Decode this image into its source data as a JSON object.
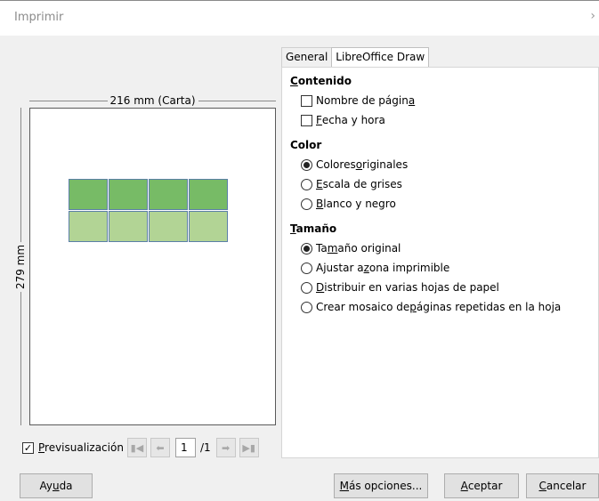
{
  "window": {
    "title": "Imprimir",
    "collapse_glyph": "›"
  },
  "preview": {
    "width_label": "216 mm (Carta)",
    "height_label": "279 mm",
    "checkbox_checked": true,
    "checkbox_label_pre": "",
    "checkbox_label_u": "P",
    "checkbox_label_post": "revisualización",
    "current_page": "1",
    "page_count": "/1",
    "nav_icons": [
      "first-page-icon",
      "previous-page-icon",
      "next-page-icon",
      "last-page-icon"
    ]
  },
  "tabs": [
    {
      "label": "General",
      "active": false
    },
    {
      "label": "LibreOffice Draw",
      "active": true
    }
  ],
  "contenido": {
    "heading_u": "C",
    "heading_rest": "ontenido",
    "options": [
      {
        "pre": "Nombre de págin",
        "u": "a",
        "post": "",
        "checked": false
      },
      {
        "pre": "",
        "u": "F",
        "post": "echa y hora",
        "checked": false
      }
    ]
  },
  "color": {
    "heading": "Color",
    "options": [
      {
        "pre": "Colores ",
        "u": "o",
        "post": "riginales",
        "selected": true
      },
      {
        "pre": "",
        "u": "E",
        "post": "scala de grises",
        "selected": false
      },
      {
        "pre": "",
        "u": "B",
        "post": "lanco y negro",
        "selected": false
      }
    ]
  },
  "tamano": {
    "heading_u": "T",
    "heading_rest": "amaño",
    "options": [
      {
        "pre": "Ta",
        "u": "m",
        "post": "año original",
        "selected": true
      },
      {
        "pre": "Ajustar a ",
        "u": "z",
        "post": "ona imprimible",
        "selected": false
      },
      {
        "pre": "",
        "u": "D",
        "post": "istribuir en varias hojas de papel",
        "selected": false
      },
      {
        "pre": "Crear mosaico de ",
        "u": "p",
        "post": "áginas repetidas en la hoja",
        "selected": false
      }
    ]
  },
  "buttons": {
    "help": {
      "pre": "Ay",
      "u": "u",
      "post": "da"
    },
    "more": {
      "pre": "",
      "u": "M",
      "post": "ás opciones..."
    },
    "ok": {
      "pre": "",
      "u": "A",
      "post": "ceptar"
    },
    "cancel": {
      "pre": "",
      "u": "C",
      "post": "ancelar"
    }
  },
  "colors": {
    "cell_dark": "#77bb66",
    "cell_light": "#b2d495",
    "cell_border": "#5b7fa8"
  }
}
